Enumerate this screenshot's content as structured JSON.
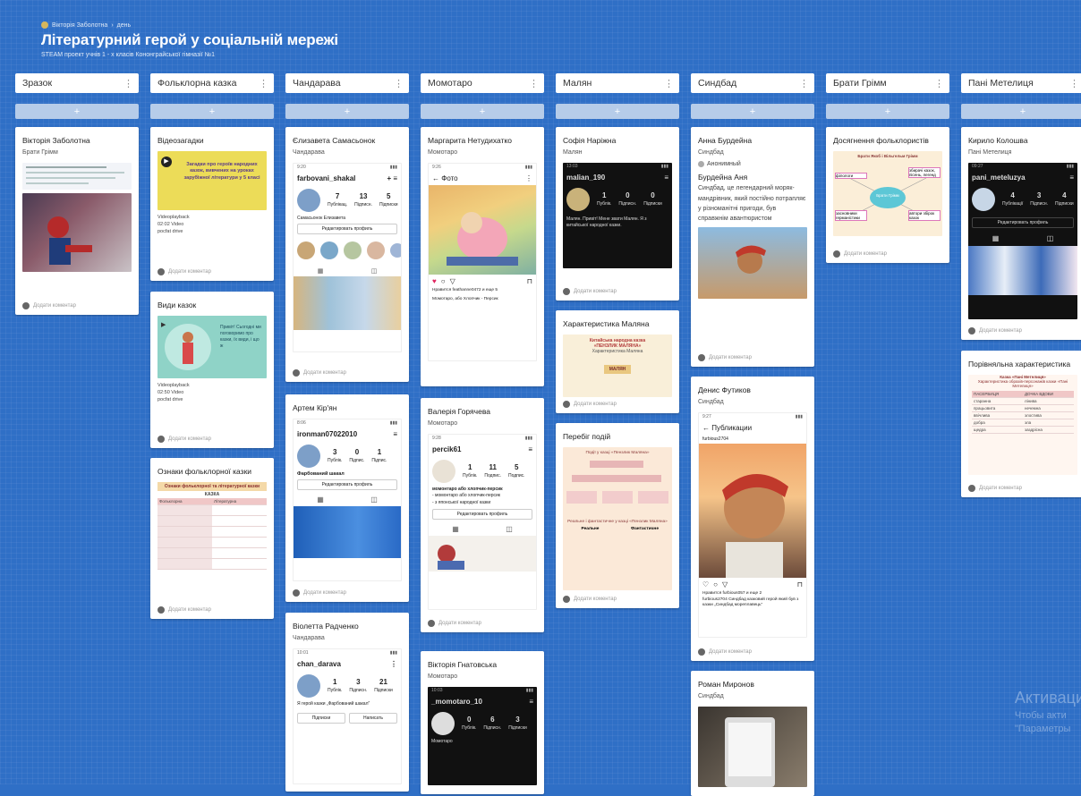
{
  "header": {
    "breadcrumb_user": "Вікторія Заболотна",
    "breadcrumb_page": "день",
    "title": "Літературний герой у соціальній мережі",
    "subtitle": "STEAM проект учнів 1 - х класів Кононграйської гімназії №1"
  },
  "add_label": "+",
  "comment_label": "Додати коментар",
  "columns": [
    {
      "title": "Зразок"
    },
    {
      "title": "Фольклорна казка"
    },
    {
      "title": "Чандарава"
    },
    {
      "title": "Момотаро"
    },
    {
      "title": "Малян"
    },
    {
      "title": "Синдбад"
    },
    {
      "title": "Брати Грімм"
    },
    {
      "title": "Пані Метелиця"
    }
  ],
  "cards": {
    "c0_0": {
      "title": "Вікторія Заболотна",
      "author": "Брати Грімм"
    },
    "c1_0": {
      "title": "Відеозагадки",
      "video_text": "Загадки про героїв народних казок, вивчених на уроках зарубіжної літератури у 5 класі",
      "meta1": "Videoplayback",
      "meta2": "02:02 Video",
      "meta3": "pocfat drive"
    },
    "c1_1": {
      "title": "Види казок",
      "video_text": "Привіт! Сьогодні ми поговоримо про казки, їх види, і що ж",
      "meta1": "Videoplayback",
      "meta2": "02:50 Video",
      "meta3": "pocfat drive"
    },
    "c1_2": {
      "title": "Ознаки фольклорної казки",
      "table_title": "Ознаки фольклорної та літературної казки",
      "table_sub": "КАЗКА",
      "col_a": "Фольклорна",
      "col_b": "Літературна"
    },
    "c2_0": {
      "title": "Єлизавета Самасьонок",
      "author": "Чандарава",
      "username": "farbovani_shakal",
      "s1": "7",
      "s1l": "Публікац.",
      "s2": "13",
      "s2l": "Підписн.",
      "s3": "5",
      "s3l": "Підписки",
      "bio": "Самасьонок Елизавета",
      "edit": "Редактировать профиль"
    },
    "c2_1": {
      "title": "Артем Кір'ян",
      "username": "ironman07022010",
      "s1": "3",
      "s1l": "Публік.",
      "s2": "0",
      "s2l": "Підпис.",
      "s3": "1",
      "s3l": "Підпис.",
      "bio": "Фарбований шакал",
      "edit": "Редактировать профиль"
    },
    "c2_2": {
      "title": "Віолетта Радченко",
      "author": "Чандарава",
      "username": "chan_darava",
      "s1": "1",
      "s1l": "Публік.",
      "s2": "3",
      "s2l": "Підписн.",
      "s3": "21",
      "s3l": "Підписки",
      "bio": "Я герой казки „Фарбований шакал”",
      "btn1": "Підписки",
      "btn2": "Написать"
    },
    "c3_0": {
      "title": "Маргарита Нетудихатко",
      "author": "Момотаро",
      "header_label": "Фото",
      "likes": "Нравится feathanne0472 и еще 5",
      "caption": "Момотаро, або Хлопчик - Персик"
    },
    "c3_1": {
      "title": "Валерія Горячева",
      "author": "Момотаро",
      "username": "percik61",
      "s1": "1",
      "s1l": "Публік.",
      "s2": "11",
      "s2l": "Подпис.",
      "s3": "5",
      "s3l": "Подпис.",
      "bio1": "момонтаро або хлопчик-персик",
      "bio2": "- момонтаро або хлопчик-персик",
      "bio3": "- з японської народної казки",
      "edit": "Редактировать профиль"
    },
    "c3_2": {
      "title": "Вікторія Гнатовська",
      "author": "Момотаро",
      "username": "_momotaro_10",
      "s1": "0",
      "s1l": "Публік.",
      "s2": "6",
      "s2l": "Підписн.",
      "s3": "3",
      "s3l": "Підписки",
      "bio": "Момотаро"
    },
    "c4_0": {
      "title": "Софія Наріжна",
      "author": "Малян",
      "username": "malian_190",
      "s1": "1",
      "s1l": "Публік.",
      "s2": "0",
      "s2l": "Підписн.",
      "s3": "0",
      "s3l": "Підписки",
      "bio": "Малян. Привіт! Мене звати Малян. Я з китайської народної казки."
    },
    "c4_1": {
      "title": "Характеристика Маляна",
      "poster1": "Китайська народна казка",
      "poster2": "«ПЕНЗЛИК МАЛЯНА»",
      "poster3": "Характеристика Маляна",
      "center": "МАЛЯН"
    },
    "c4_2": {
      "title": "Перебіг подій",
      "poster1": "Події у казці «Пензлик Маляна»",
      "poster2": "Реальне і фантастичне у казці «Пензлик Маляна»",
      "col_a": "Реальне",
      "col_b": "Фантастичне"
    },
    "c5_0": {
      "title": "Анна Бурдейна",
      "author": "Синдбад",
      "anon": "Анонимный",
      "name2": "Бурдейна Аня",
      "text": "Синдбад, це легендарний моряк-мандрівник, який постійно потрапляє у різноманітні пригоди, був справжнім авантюристом"
    },
    "c5_1": {
      "title": "Денис Футиков",
      "author": "Синдбад",
      "header_label": "Публикации",
      "username": "furbious2704",
      "likes": "Нравится furbious057 и еще 2",
      "caption": "furbious2704 Синдбад казковий герой який був з казки „Синдбад мореплавець”"
    },
    "c5_2": {
      "title": "Роман Миронов",
      "author": "Синдбад"
    },
    "c6_0": {
      "title": "Досягнення фольклористів",
      "poster": "Брати Якоб і Вільгельм Грімм",
      "center": "Брати Грімм",
      "n1": "філологи",
      "n2": "збирачі казок, пісень, легенд",
      "n3": "засновники германістики",
      "n4": "автори збірок казок"
    },
    "c7_0": {
      "title": "Кирило Колошва",
      "author": "Пані Метелиця",
      "username": "pani_meteluzya",
      "s1": "4",
      "s1l": "Публікації",
      "s2": "3",
      "s2l": "Підписн.",
      "s3": "4",
      "s3l": "Підписки",
      "edit": "Редактировать профиль"
    },
    "c7_1": {
      "title": "Порівняльна характеристика",
      "poster1": "Казка «Пані Метелиця»",
      "poster2": "Характеристика образів-персонажів казки «Пані Метелиця»",
      "col_a": "ПАСЕРБИЦЯ",
      "col_b": "ДОЧКА ВДОВИ",
      "rows": [
        [
          "старанна",
          "лінива"
        ],
        [
          "працьовита",
          "нечемна"
        ],
        [
          "ввічлива",
          "злостива"
        ],
        [
          "добра",
          "зла"
        ],
        [
          "щедра",
          "заздрісна"
        ]
      ]
    }
  },
  "watermark": {
    "line1": "Активаци",
    "line2": "Чтобы акти",
    "line3": "\"Параметры"
  },
  "colors": {
    "background": "#2f6fc6",
    "card": "#ffffff",
    "add_button": "#b6cce9"
  }
}
